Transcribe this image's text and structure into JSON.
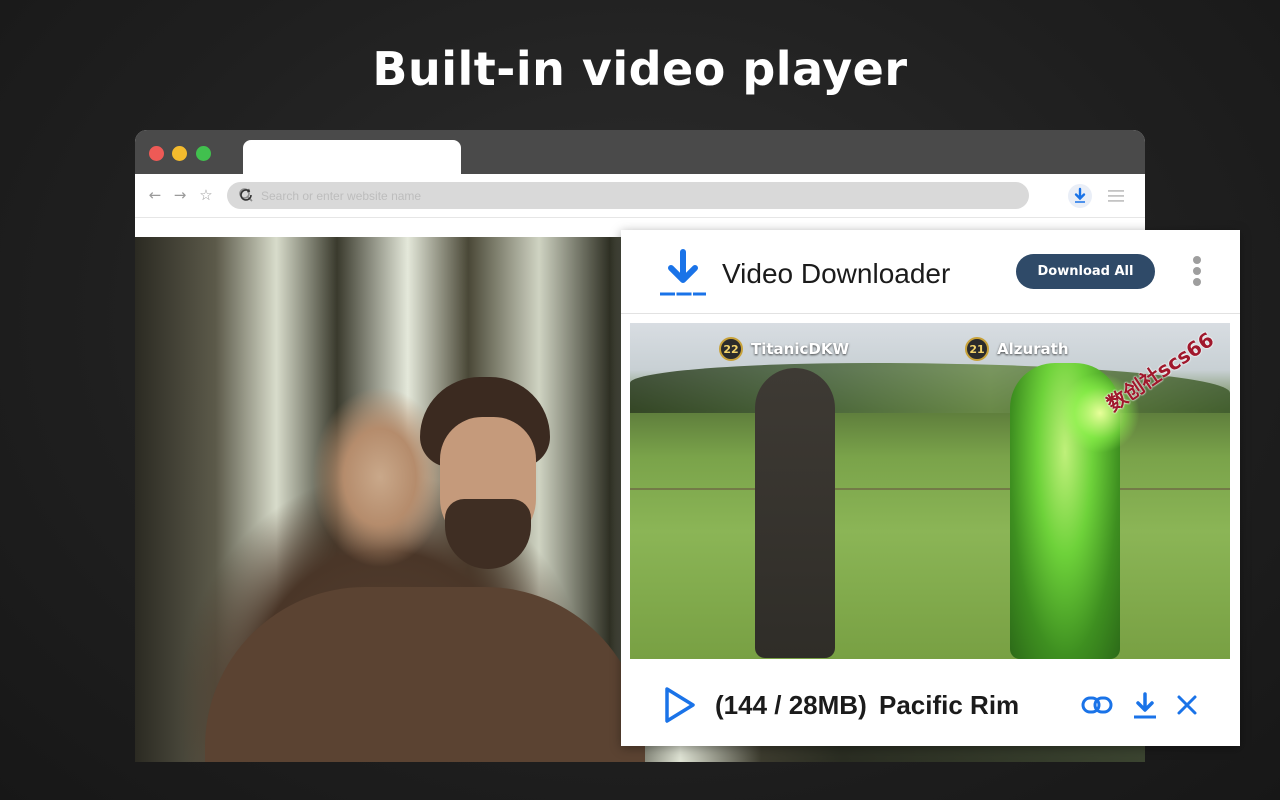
{
  "headline": "Built-in video player",
  "browser": {
    "search_placeholder": "Search or enter website name"
  },
  "popup": {
    "title": "Video Downloader",
    "download_all_label": "Download All",
    "video": {
      "players": [
        {
          "level": "22",
          "name": "TitanicDKW"
        },
        {
          "level": "21",
          "name": "Alzurath"
        }
      ],
      "watermark": "数创社scs66"
    },
    "item": {
      "size": "(144 / 28MB)",
      "title": "Pacific Rim"
    }
  },
  "colors": {
    "accent_blue": "#1a73e8",
    "download_all_bg": "#2f4a68",
    "close_red": "#ee5a56",
    "minimize_yellow": "#f4bb2d",
    "zoom_green": "#41c04e"
  },
  "icons": [
    "back-arrow-icon",
    "forward-arrow-icon",
    "star-icon",
    "search-icon",
    "reload-icon",
    "download-extension-icon",
    "hamburger-menu-icon",
    "download-logo-icon",
    "kebab-menu-icon",
    "play-icon",
    "link-icon",
    "download-icon",
    "close-icon"
  ]
}
